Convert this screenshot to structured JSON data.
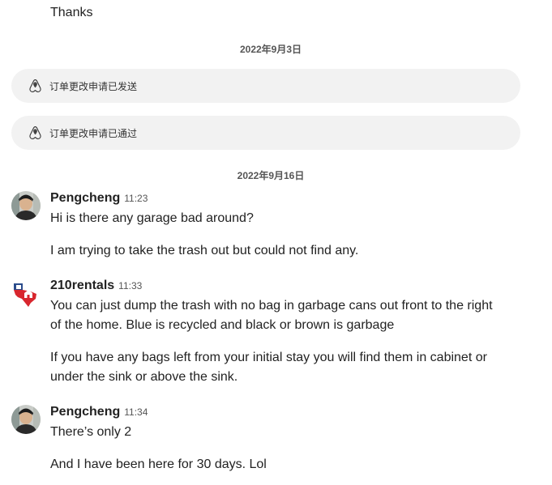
{
  "conversation": {
    "top_partial": {
      "last_line": "Thanks"
    },
    "date_1": "2022年9月3日",
    "system_messages": [
      {
        "text": "订单更改申请已发送",
        "icon": "airbnb-logo-icon"
      },
      {
        "text": "订单更改申请已通过",
        "icon": "airbnb-logo-icon"
      }
    ],
    "date_2": "2022年9月16日",
    "messages": [
      {
        "sender": "Pengcheng",
        "time": "11:23",
        "avatar": "user-photo",
        "lines": [
          "Hi is there any garage bad around?",
          "I am trying to take the trash out but could not find any."
        ]
      },
      {
        "sender": "210rentals",
        "time": "11:33",
        "avatar": "texas-flag-house-logo",
        "lines": [
          "You can just dump the trash with no bag in garbage cans out front to the right",
          "of the home. Blue is recycled and black or brown is garbage",
          "If you have any bags left from your initial stay you will find them in cabinet or",
          "under the sink or above the sink."
        ]
      },
      {
        "sender": "Pengcheng",
        "time": "11:34",
        "avatar": "user-photo",
        "lines": [
          "There’s only 2",
          "And I have been here for 30 days. Lol"
        ]
      }
    ]
  }
}
